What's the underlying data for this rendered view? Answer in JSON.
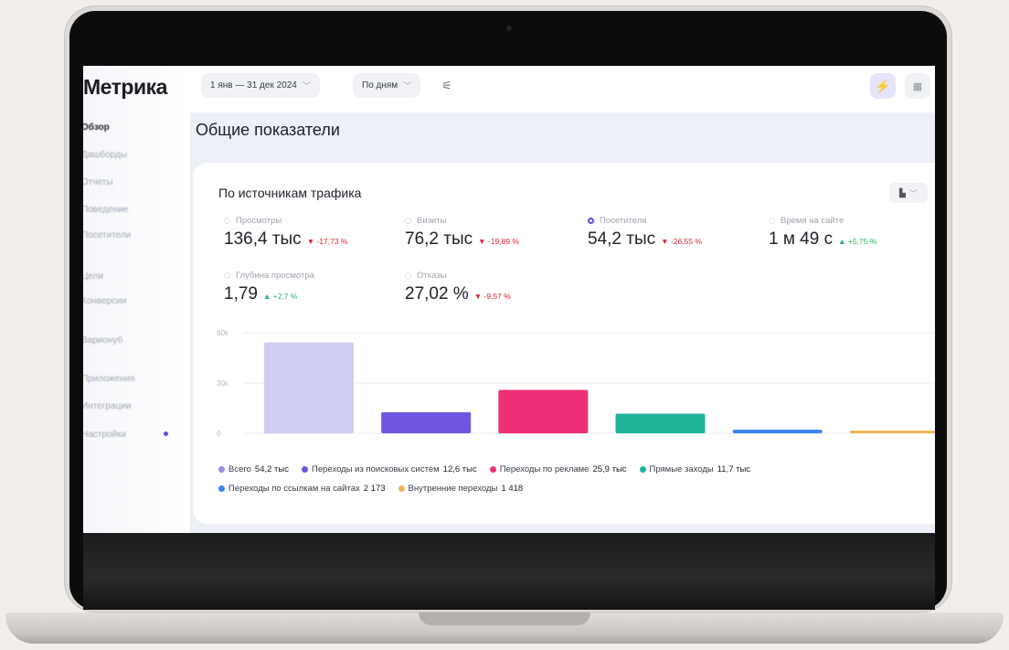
{
  "app": {
    "logo": "Метрика"
  },
  "sidebar": {
    "items": [
      {
        "label": "Обзор",
        "active": true
      },
      {
        "label": "Дашборды"
      },
      {
        "label": "Отчеты"
      },
      {
        "label": "Поведение"
      },
      {
        "label": "Посетители"
      },
      {
        "label": "Цели"
      },
      {
        "label": "Конверсии"
      },
      {
        "label": "Варионуб"
      },
      {
        "label": "Приложения"
      },
      {
        "label": "Интеграции"
      },
      {
        "label": "Настройки"
      }
    ]
  },
  "toolbar": {
    "date_range": "1 янв — 31 дек 2024",
    "grouping": "По дням",
    "settings_icon": "sliders-icon",
    "bolt_icon": "lightning-icon",
    "grid_icon": "grid-icon"
  },
  "page": {
    "title": "Общие показатели"
  },
  "card": {
    "title": "По источникам трафика",
    "chart_type_icon": "bar-chart-icon"
  },
  "metrics": [
    {
      "label": "Просмотры",
      "value": "136,4 тыс",
      "delta": "▼ -17,73 %",
      "trend": "neg",
      "selected": false
    },
    {
      "label": "Визиты",
      "value": "76,2 тыс",
      "delta": "▼ -19,89 %",
      "trend": "neg",
      "selected": false
    },
    {
      "label": "Посетители",
      "value": "54,2 тыс",
      "delta": "▼ -26,55 %",
      "trend": "neg",
      "selected": true
    },
    {
      "label": "Время на сайте",
      "value": "1 м 49 с",
      "delta": "▲ +5,75 %",
      "trend": "pos",
      "selected": false
    },
    {
      "label": "Глубина просмотра",
      "value": "1,79",
      "delta": "▲ +2,7 %",
      "trend": "pos",
      "selected": false
    },
    {
      "label": "Отказы",
      "value": "27,02 %",
      "delta": "▼ -9,57 %",
      "trend": "neg",
      "selected": false
    }
  ],
  "chart_data": {
    "type": "bar",
    "categories": [
      "Всего",
      "Переходы из поисковых систем",
      "Переходы по рекламе",
      "Прямые заходы",
      "Переходы по ссылкам на сайтах",
      "Внутренние переходы"
    ],
    "values": [
      54200,
      12600,
      25900,
      11700,
      2173,
      1418
    ],
    "colors": [
      "#cfcdf4",
      "#6f55e0",
      "#ee2f77",
      "#1fb39a",
      "#3a86f0",
      "#f0b85a"
    ],
    "y_ticks": [
      "60k",
      "30k",
      "0"
    ],
    "ylim": [
      0,
      60000
    ],
    "grid": true,
    "legend": "bottom"
  },
  "legend": [
    {
      "label": "Всего",
      "value": "54,2 тыс",
      "color": "#9a8de6"
    },
    {
      "label": "Переходы из поисковых систем",
      "value": "12,6 тыс",
      "color": "#6f55e0"
    },
    {
      "label": "Переходы по рекламе",
      "value": "25,9 тыс",
      "color": "#ee2f77"
    },
    {
      "label": "Прямые заходы",
      "value": "11,7 тыс",
      "color": "#1fb39a"
    },
    {
      "label": "Переходы по ссылкам на сайтах",
      "value": "2 173",
      "color": "#3a86f0"
    },
    {
      "label": "Внутренние переходы",
      "value": "1 418",
      "color": "#f0b85a"
    }
  ]
}
